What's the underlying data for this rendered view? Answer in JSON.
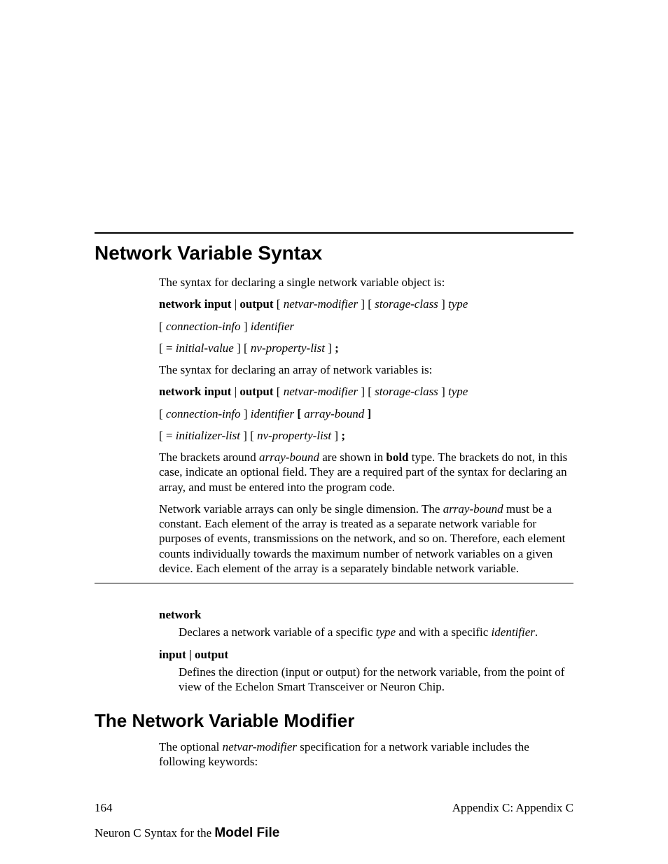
{
  "headings": {
    "h1": "Network Variable Syntax",
    "h2": "The Network Variable Modifier"
  },
  "intro": {
    "p1": "The syntax for declaring a single network variable object is:",
    "syntax1_runs": [
      {
        "t": "network input",
        "c": "b"
      },
      {
        "t": " | ",
        "c": ""
      },
      {
        "t": "output",
        "c": "b"
      },
      {
        "t": "  [ ",
        "c": ""
      },
      {
        "t": "netvar-modifier",
        "c": "i"
      },
      {
        "t": " ] [ ",
        "c": ""
      },
      {
        "t": "storage-class",
        "c": "i"
      },
      {
        "t": " ] ",
        "c": ""
      },
      {
        "t": "type",
        "c": "i"
      }
    ],
    "syntax1b_runs": [
      {
        "t": "[ ",
        "c": ""
      },
      {
        "t": "connection-info",
        "c": "i"
      },
      {
        "t": " ] ",
        "c": ""
      },
      {
        "t": "identifier",
        "c": "i"
      }
    ],
    "syntax1c_runs": [
      {
        "t": "[ = ",
        "c": ""
      },
      {
        "t": "initial-value",
        "c": "i"
      },
      {
        "t": " ] [ ",
        "c": ""
      },
      {
        "t": "nv-property-list",
        "c": "i"
      },
      {
        "t": " ] ",
        "c": ""
      },
      {
        "t": ";",
        "c": "b"
      }
    ],
    "p2": "The syntax for declaring an array of network variables is:",
    "syntax2_runs": [
      {
        "t": "network input",
        "c": "b"
      },
      {
        "t": " | ",
        "c": ""
      },
      {
        "t": "output",
        "c": "b"
      },
      {
        "t": "  [ ",
        "c": ""
      },
      {
        "t": "netvar-modifier",
        "c": "i"
      },
      {
        "t": " ] [ ",
        "c": ""
      },
      {
        "t": "storage-class",
        "c": "i"
      },
      {
        "t": " ] ",
        "c": ""
      },
      {
        "t": "type",
        "c": "i"
      }
    ],
    "syntax2b_runs": [
      {
        "t": "[ ",
        "c": ""
      },
      {
        "t": "connection-info",
        "c": "i"
      },
      {
        "t": " ] ",
        "c": ""
      },
      {
        "t": "identifier",
        "c": "i"
      },
      {
        "t": " [ ",
        "c": "b"
      },
      {
        "t": "array-bound",
        "c": "i"
      },
      {
        "t": " ]",
        "c": "b"
      }
    ],
    "syntax2c_runs": [
      {
        "t": "[ = ",
        "c": ""
      },
      {
        "t": "initializer-list",
        "c": "i"
      },
      {
        "t": " ] [ ",
        "c": ""
      },
      {
        "t": "nv-property-list",
        "c": "i"
      },
      {
        "t": " ] ",
        "c": ""
      },
      {
        "t": ";",
        "c": "b"
      }
    ],
    "p3_runs": [
      {
        "t": "The brackets around ",
        "c": ""
      },
      {
        "t": "array-bound",
        "c": "i"
      },
      {
        "t": " are shown in ",
        "c": ""
      },
      {
        "t": "bold",
        "c": "b"
      },
      {
        "t": " type.  The brackets do not, in this case, indicate an optional field.  They are a required part of the syntax for declaring an array, and must be entered into the program code.",
        "c": ""
      }
    ],
    "p4_runs": [
      {
        "t": "Network variable arrays can only be single dimension.  The ",
        "c": ""
      },
      {
        "t": "array-bound",
        "c": "i"
      },
      {
        "t": " must be a constant.  Each element of the array is treated as a separate network variable for purposes of events, transmissions on the network, and so on.  Therefore, each element counts individually towards the maximum number of network variables on a given device.  Each element of the array is a separately bindable network variable.",
        "c": ""
      }
    ]
  },
  "terms": {
    "t1_label": "network",
    "t1_desc_runs": [
      {
        "t": "Declares a network variable of a specific ",
        "c": ""
      },
      {
        "t": "type",
        "c": "i"
      },
      {
        "t": " and with a specific ",
        "c": ""
      },
      {
        "t": "identifier",
        "c": "i"
      },
      {
        "t": ".",
        "c": ""
      }
    ],
    "t2_label": "input | output",
    "t2_desc": "Defines the direction (input or output) for the network variable, from the point of view of the Echelon Smart Transceiver or Neuron Chip."
  },
  "nvmod": {
    "p_runs": [
      {
        "t": "The optional ",
        "c": ""
      },
      {
        "t": "netvar-modifier",
        "c": "i"
      },
      {
        "t": " specification for a network variable includes the following keywords:",
        "c": ""
      }
    ]
  },
  "footer": {
    "pageno": "164",
    "appendix": "Appendix C: Appendix C",
    "line2a": "Neuron C Syntax for the ",
    "line2b": "Model File"
  }
}
